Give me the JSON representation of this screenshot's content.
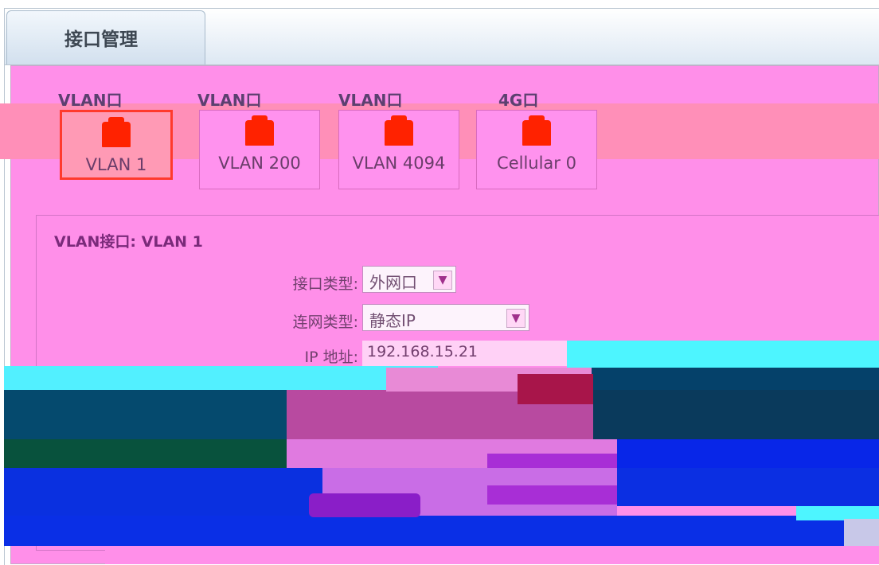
{
  "tabs": [
    {
      "label": "接口管理",
      "active": true
    }
  ],
  "port_groups": [
    {
      "legend": "VLAN口",
      "card": {
        "label": "VLAN 1",
        "active": true
      }
    },
    {
      "legend": "VLAN口",
      "card": {
        "label": "VLAN 200",
        "active": false
      }
    },
    {
      "legend": "VLAN口",
      "card": {
        "label": "VLAN 4094",
        "active": false
      }
    },
    {
      "legend": "4G口",
      "card": {
        "label": "Cellular 0",
        "active": false
      }
    }
  ],
  "detail": {
    "title": "VLAN接口: VLAN 1",
    "interface_type": {
      "label": "接口类型:",
      "value": "外网口"
    },
    "connection_type": {
      "label": "连网类型:",
      "value": "静态IP"
    },
    "ip_address": {
      "label": "IP 地址:",
      "value": "192.168.15.21"
    }
  },
  "colors": {
    "accent_active": "#ff3a2c",
    "port_icon": "#ff2200"
  }
}
